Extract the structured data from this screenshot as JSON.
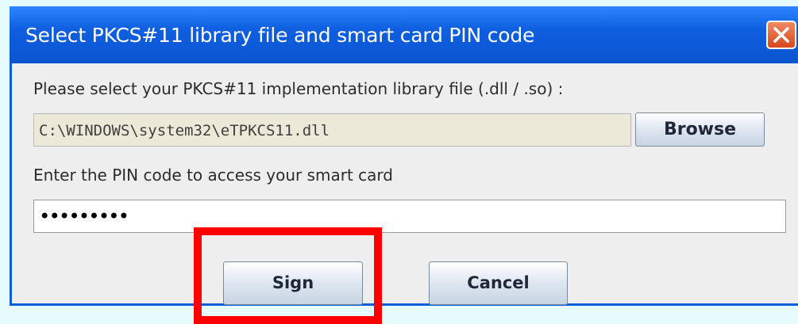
{
  "dialog": {
    "title": "Select PKCS#11 library file and smart card PIN code",
    "library_prompt": "Please select your PKCS#11 implementation library file (.dll / .so) :",
    "library_path": "C:\\WINDOWS\\system32\\eTPKCS11.dll",
    "browse_label": "Browse",
    "pin_prompt": "Enter the PIN code to access your smart card",
    "pin_value": "•••••••••",
    "sign_label": "Sign",
    "cancel_label": "Cancel",
    "close_icon": "close-icon"
  },
  "colors": {
    "titlebar": "#0a5ed8",
    "close_button": "#d8471c",
    "highlight": "#ff0000",
    "background": "#e6fbfb"
  }
}
